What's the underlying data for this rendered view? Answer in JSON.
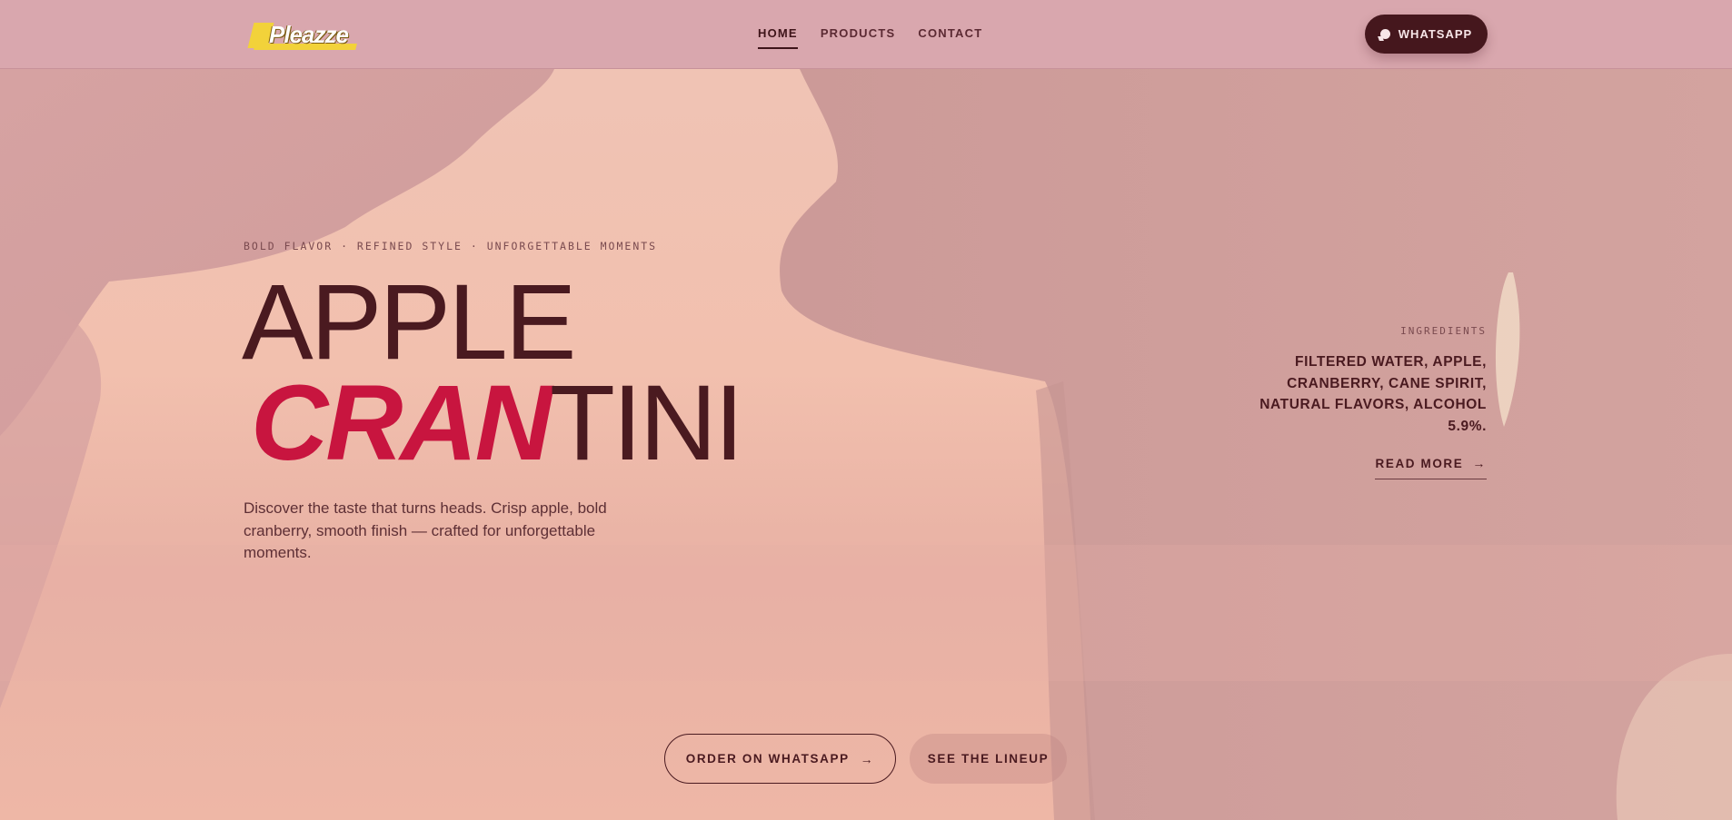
{
  "header": {
    "logo_text": "Pleazze",
    "nav": [
      {
        "label": "HOME",
        "active": true
      },
      {
        "label": "PRODUCTS",
        "active": false
      },
      {
        "label": "CONTACT",
        "active": false
      }
    ],
    "whatsapp_label": "WHATSAPP"
  },
  "hero": {
    "tagline": "BOLD FLAVOR · REFINED STYLE · UNFORGETTABLE MOMENTS",
    "title_line1": "APPLE",
    "title_cran": "CRAN",
    "title_tini": "TINI",
    "description": "Discover the taste that turns heads. Crisp apple, bold cranberry, smooth finish — crafted for unforgettable moments."
  },
  "ingredients": {
    "label": "INGREDIENTS",
    "text": "FILTERED WATER, APPLE, CRANBERRY, CANE SPIRIT, NATURAL FLAVORS, ALCOHOL 5.9%.",
    "read_more": "READ MORE",
    "arrow": "→"
  },
  "cta": {
    "order_label": "ORDER ON WHATSAPP",
    "order_arrow": "→",
    "lineup_label": "SEE THE LINEUP"
  },
  "colors": {
    "header_bg": "#d9a7ae",
    "accent_red": "#c8153f",
    "dark_maroon": "#4a1a20",
    "whatsapp_btn": "#45171d"
  },
  "icons": {
    "whatsapp": "chat-bubble-icon",
    "arrow": "arrow-right-icon"
  }
}
